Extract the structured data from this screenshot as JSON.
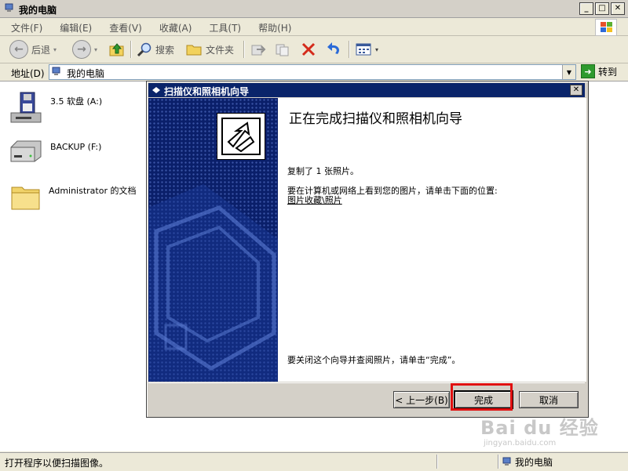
{
  "window": {
    "title": "我的电脑"
  },
  "menu": {
    "items": [
      "文件(F)",
      "编辑(E)",
      "查看(V)",
      "收藏(A)",
      "工具(T)",
      "帮助(H)"
    ]
  },
  "toolbar": {
    "back_label": "后退",
    "search_label": "搜索",
    "folders_label": "文件夹"
  },
  "address": {
    "label": "地址(D)",
    "value": "我的电脑",
    "go_label": "转到"
  },
  "items": [
    {
      "label": "3.5 软盘 (A:)",
      "icon": "floppy-drive-icon"
    },
    {
      "label": "BACKUP (F:)",
      "icon": "hard-drive-icon"
    },
    {
      "label": "Administrator 的文档",
      "icon": "folder-icon"
    }
  ],
  "dialog": {
    "title": "扫描仪和照相机向导",
    "heading": "正在完成扫描仪和照相机向导",
    "copied_text": "复制了 1 张照片。",
    "instruction": "要在计算机或网络上看到您的图片，请单击下面的位置:",
    "link": "图片收藏\\照片",
    "close_hint": "要关闭这个向导并查阅照片，请单击“完成”。",
    "back_button": "< 上一步(B)",
    "finish_button": "完成",
    "cancel_button": "取消"
  },
  "status": {
    "left": "打开程序以便扫描图像。",
    "right": "我的电脑"
  },
  "watermark": {
    "text": "Bai du 经验",
    "sub": "jingyan.baidu.com"
  },
  "colors": {
    "dialog_titlebar": "#0a246a",
    "wizard_side": "#0a1f6a",
    "highlight": "#e01010"
  }
}
